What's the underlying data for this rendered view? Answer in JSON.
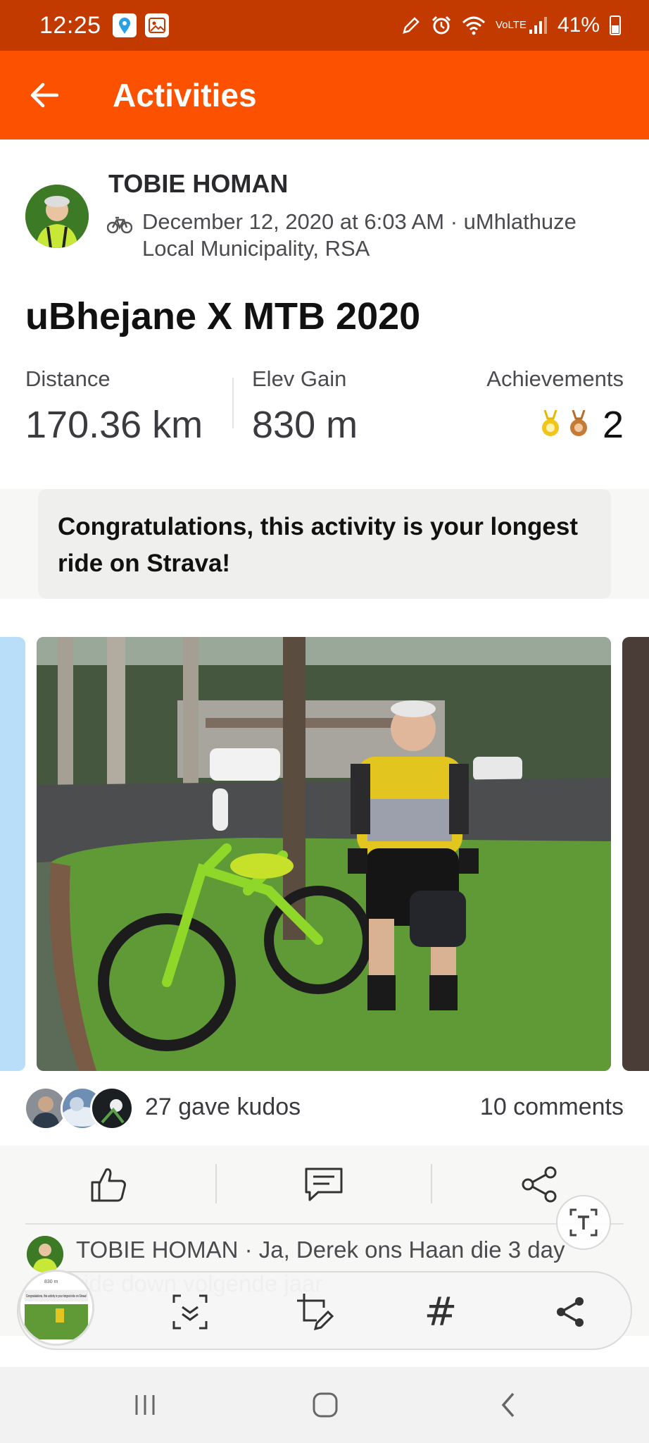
{
  "status_bar": {
    "time": "12:25",
    "network": "VoLTE",
    "battery": "41%"
  },
  "header": {
    "title": "Activities"
  },
  "athlete": {
    "name": "TOBIE HOMAN",
    "meta": "December 12, 2020 at 6:03 AM · uMhlathuze Local Municipality, RSA"
  },
  "activity": {
    "title": "uBhejane X MTB 2020",
    "stats": {
      "distance_label": "Distance",
      "distance_value": "170.36 km",
      "elev_label": "Elev Gain",
      "elev_value": "830 m",
      "achievements_label": "Achievements",
      "achievements_value": "2"
    }
  },
  "congrats": "Congratulations, this activity is your longest ride on Strava!",
  "social": {
    "kudos": "27 gave kudos",
    "comments": "10 comments"
  },
  "comment": {
    "text": "TOBIE HOMAN · Ja, Derek ons Haan die 3 day ride down volgende jaar"
  },
  "thumbnail": {
    "value": "830 m",
    "caption": "Congratulations, this activity is your longest ride on Strava!"
  },
  "colors": {
    "brand": "#fc5200",
    "status_bar": "#c23a00"
  }
}
